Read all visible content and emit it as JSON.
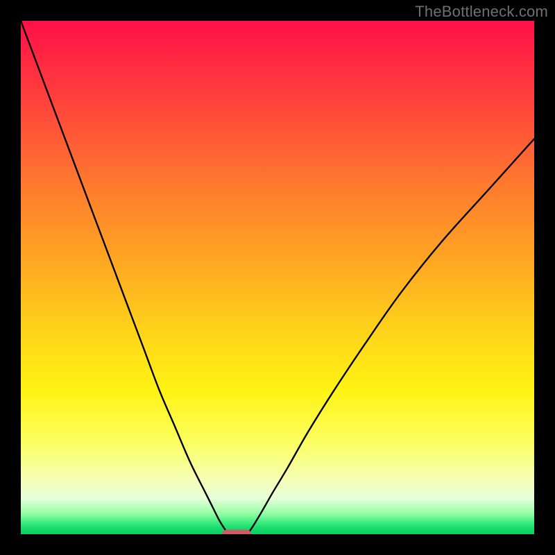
{
  "watermark": "TheBottleneck.com",
  "chart_data": {
    "type": "line",
    "title": "",
    "xlabel": "",
    "ylabel": "",
    "xlim": [
      0,
      100
    ],
    "ylim": [
      0,
      100
    ],
    "grid": false,
    "series": [
      {
        "name": "left-branch",
        "x": [
          0,
          3,
          6,
          9,
          12,
          15,
          18,
          21,
          24,
          27,
          30,
          33,
          36,
          37.5,
          38.5,
          39.2,
          39.8,
          40.2,
          40.5
        ],
        "y": [
          100,
          92,
          84,
          76,
          68,
          60,
          52,
          44,
          36,
          28,
          21,
          14,
          8,
          5,
          3,
          1.8,
          0.9,
          0.3,
          0
        ]
      },
      {
        "name": "right-branch",
        "x": [
          44,
          44.5,
          45.5,
          47,
          49,
          52,
          56,
          61,
          67,
          74,
          82,
          91,
          100
        ],
        "y": [
          0,
          0.5,
          2,
          4.5,
          8,
          13,
          20,
          28,
          37,
          47,
          57,
          67,
          77
        ]
      }
    ],
    "minimum_marker": {
      "x": 42,
      "y": 0
    },
    "background_gradient": {
      "top": "#ff1048",
      "mid": "#ffd21a",
      "bottom": "#0bcf63"
    },
    "annotations": []
  }
}
